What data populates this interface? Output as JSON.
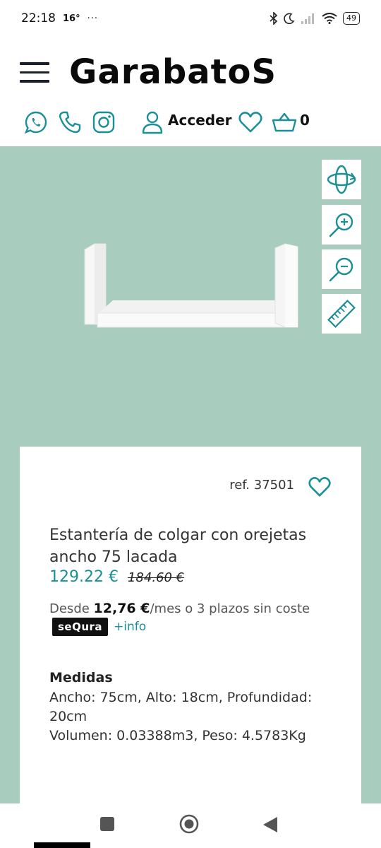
{
  "status_bar": {
    "time": "22:18",
    "temp": "16°",
    "dots": "···",
    "battery": "49"
  },
  "header": {
    "logo": "GarabatoS"
  },
  "iconbar": {
    "login_label": "Acceder",
    "cart_count": "0"
  },
  "product": {
    "ref": "ref. 37501",
    "title": "Estantería de colgar con orejetas ancho 75 lacada",
    "price": "129.22 €",
    "old_price": "184.60 €",
    "financing_prefix": "Desde ",
    "financing_amount": "12,76 €",
    "financing_suffix": "/mes o 3 plazos sin coste",
    "sequra_label": "seQura",
    "info_link": "+info",
    "medidas_title": "Medidas",
    "medidas_line1": "Ancho: 75cm, Alto: 18cm, Profundidad: 20cm",
    "medidas_line2": "Volumen: 0.03388m3, Peso: 4.5783Kg"
  },
  "colors": {
    "accent": "#1a8f95",
    "background_panel": "#a8cdbf"
  }
}
